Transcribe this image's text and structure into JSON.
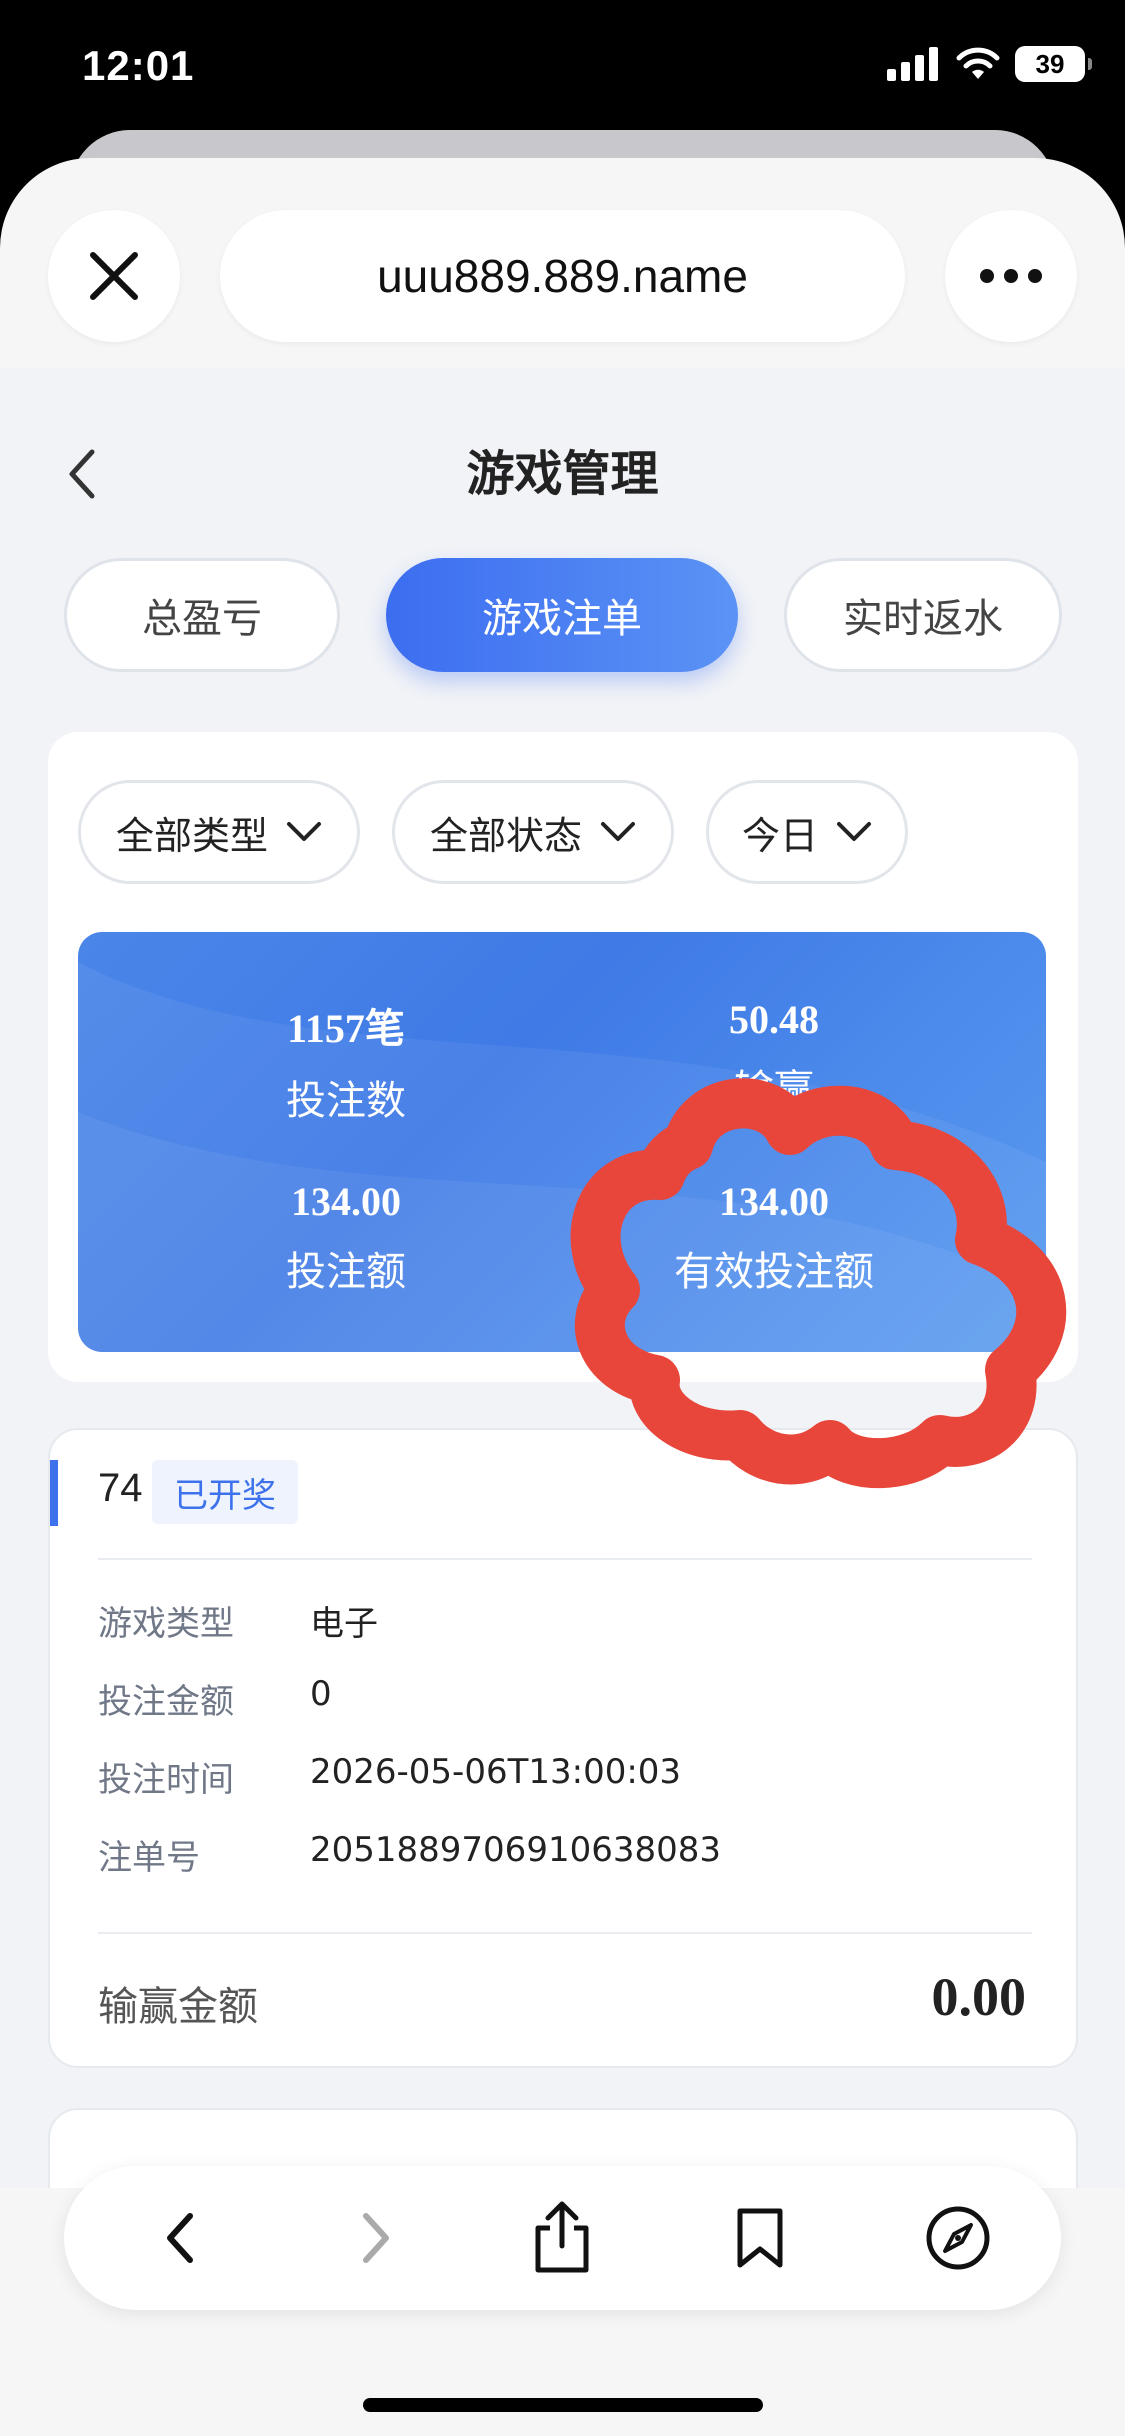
{
  "status_bar": {
    "time": "12:01",
    "battery": "39"
  },
  "browser": {
    "url": "uuu889.889.name"
  },
  "page": {
    "title": "游戏管理",
    "tabs": [
      {
        "label": "总盈亏",
        "active": false
      },
      {
        "label": "游戏注单",
        "active": true
      },
      {
        "label": "实时返水",
        "active": false
      }
    ],
    "filters": [
      {
        "label": "全部类型"
      },
      {
        "label": "全部状态"
      },
      {
        "label": "今日"
      }
    ],
    "summary": {
      "bet_count": {
        "value": "1157笔",
        "label": "投注数"
      },
      "win_loss": {
        "value": "50.48",
        "label": "输赢"
      },
      "bet_amount": {
        "value": "134.00",
        "label": "投注额"
      },
      "valid_bet_amount": {
        "value": "134.00",
        "label": "有效投注额"
      }
    },
    "bet_record": {
      "id": "74",
      "status": "已开奖",
      "fields": [
        {
          "label": "游戏类型",
          "value": "电子"
        },
        {
          "label": "投注金额",
          "value": "0"
        },
        {
          "label": "投注时间",
          "value": "2026-05-06T13:00:03"
        },
        {
          "label": "注单号",
          "value": "2051889706910638083"
        }
      ],
      "win_loss_label": "输赢金额",
      "win_loss_value": "0.00"
    }
  },
  "annotation": {
    "color": "#e8463b"
  },
  "colors": {
    "accent": "#3d72ec",
    "page_bg": "#f1f3f7"
  }
}
